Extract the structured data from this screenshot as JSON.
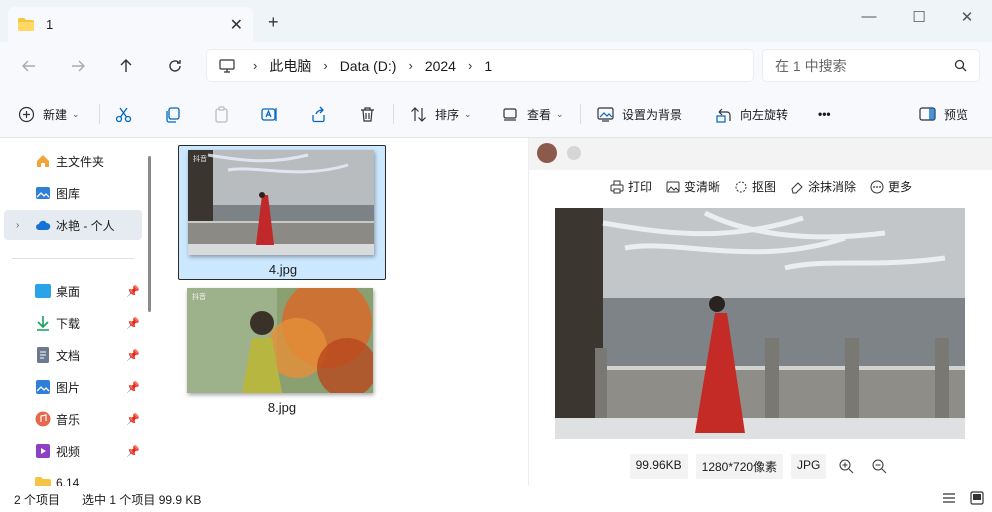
{
  "tab": {
    "title": "1",
    "close_icon": "close-icon",
    "new_tab_label": "+"
  },
  "window_controls": {
    "minimize": "—",
    "maximize": "☐",
    "close": "✕"
  },
  "address": {
    "segments": [
      "此电脑",
      "Data (D:)",
      "2024",
      "1"
    ]
  },
  "search": {
    "placeholder": "在 1 中搜索"
  },
  "toolbar": {
    "new_label": "新建",
    "sort_label": "排序",
    "view_label": "查看",
    "set_bg_label": "设置为背景",
    "rotate_label": "向左旋转",
    "more_label": "•••",
    "preview_label": "预览"
  },
  "sidebar": {
    "top_items": [
      {
        "label": "主文件夹",
        "icon": "home-icon"
      },
      {
        "label": "图库",
        "icon": "gallery-icon"
      },
      {
        "label": "冰艳 - 个人",
        "icon": "onedrive-cloud-icon"
      }
    ],
    "pinned_items": [
      {
        "label": "桌面",
        "icon": "desktop-icon"
      },
      {
        "label": "下载",
        "icon": "download-icon"
      },
      {
        "label": "文档",
        "icon": "document-icon"
      },
      {
        "label": "图片",
        "icon": "pictures-icon"
      },
      {
        "label": "音乐",
        "icon": "music-icon"
      },
      {
        "label": "视频",
        "icon": "video-icon"
      },
      {
        "label": "6.14",
        "icon": "folder-icon"
      }
    ]
  },
  "files": [
    {
      "name": "4.jpg",
      "selected": true,
      "watermark": "抖音"
    },
    {
      "name": "8.jpg",
      "selected": false,
      "watermark": "抖音"
    }
  ],
  "preview": {
    "actions": [
      "打印",
      "变清晰",
      "抠图",
      "涂抹消除",
      "更多"
    ],
    "size": "99.96KB",
    "dimensions": "1280*720像素",
    "format": "JPG"
  },
  "status": {
    "count": "2 个项目",
    "selection": "选中 1 个项目  99.9 KB"
  },
  "colors": {
    "accent": "#0067c0",
    "selected_bg": "#cce8ff",
    "tab_bar": "#eff4f9"
  }
}
